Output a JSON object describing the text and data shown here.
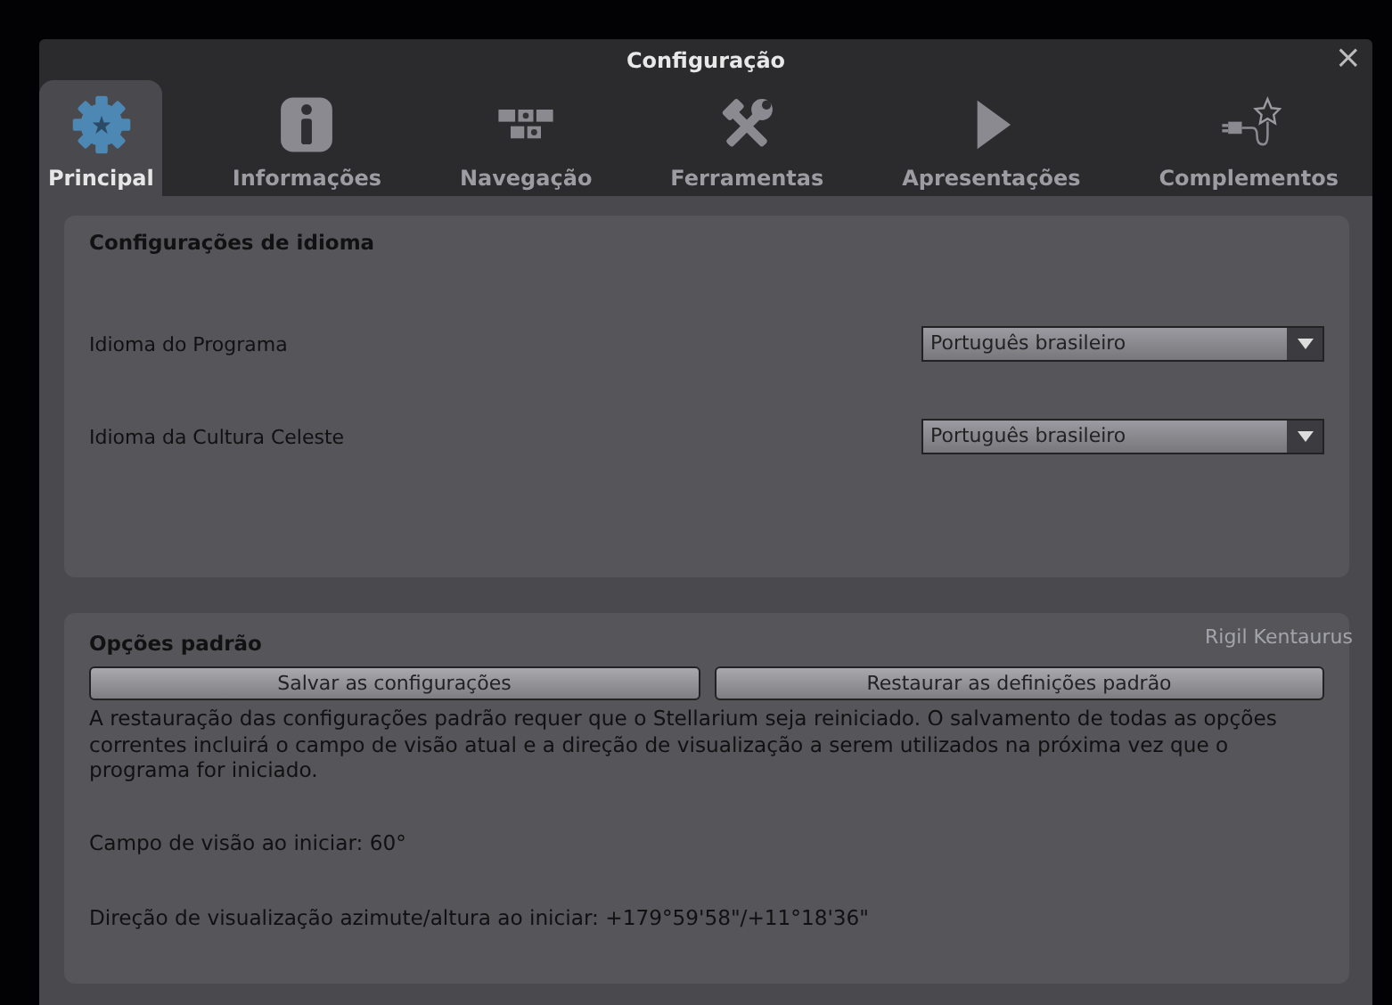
{
  "window": {
    "title": "Configuração",
    "close": "×"
  },
  "tabs": [
    {
      "label": "Principal",
      "selected": true
    },
    {
      "label": "Informações",
      "selected": false
    },
    {
      "label": "Navegação",
      "selected": false
    },
    {
      "label": "Ferramentas",
      "selected": false
    },
    {
      "label": "Apresentações",
      "selected": false
    },
    {
      "label": "Complementos",
      "selected": false
    }
  ],
  "language_section": {
    "title": "Configurações de idioma",
    "rows": [
      {
        "label": "Idioma do Programa",
        "value": "Português brasileiro"
      },
      {
        "label": "Idioma da Cultura Celeste",
        "value": "Português brasileiro"
      }
    ]
  },
  "defaults_section": {
    "title": "Opções padrão",
    "buttons": [
      "Salvar as configurações",
      "Restaurar as definições padrão"
    ],
    "note": "A restauração das configurações padrão requer que o Stellarium seja reiniciado. O salvamento de todas as opções correntes incluirá o campo de visão atual e a direção de visualização a serem utilizados na próxima vez que o programa for iniciado.",
    "fov": "Campo de visão ao iniciar: 60°",
    "direction": "Direção de visualização azimute/altura ao iniciar: +179°59'58\"/+11°18'36\""
  },
  "sky_label": "Rigil Kentaurus"
}
